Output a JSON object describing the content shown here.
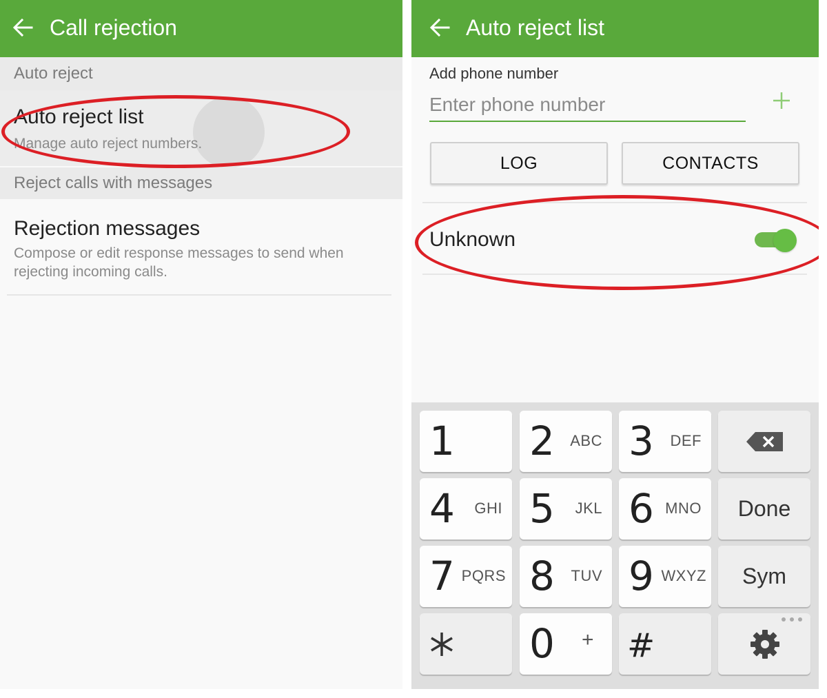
{
  "left_screen": {
    "title": "Call rejection",
    "section_auto_reject": "Auto reject",
    "auto_reject_list": {
      "title": "Auto reject list",
      "subtitle": "Manage auto reject numbers."
    },
    "section_messages": "Reject calls with messages",
    "rejection_messages": {
      "title": "Rejection messages",
      "subtitle": "Compose or edit response messages to send when rejecting incoming calls."
    }
  },
  "right_screen": {
    "title": "Auto reject list",
    "add_label": "Add phone number",
    "input_value": "",
    "input_placeholder": "Enter phone number",
    "log_button": "LOG",
    "contacts_button": "CONTACTS",
    "unknown_label": "Unknown",
    "unknown_enabled": true
  },
  "keypad": {
    "keys": [
      {
        "digit": "1",
        "letters": ""
      },
      {
        "digit": "2",
        "letters": "ABC"
      },
      {
        "digit": "3",
        "letters": "DEF"
      },
      {
        "digit": "4",
        "letters": "GHI"
      },
      {
        "digit": "5",
        "letters": "JKL"
      },
      {
        "digit": "6",
        "letters": "MNO"
      },
      {
        "digit": "7",
        "letters": "PQRS"
      },
      {
        "digit": "8",
        "letters": "TUV"
      },
      {
        "digit": "9",
        "letters": "WXYZ"
      },
      {
        "digit": "0",
        "letters": "+"
      }
    ],
    "done_label": "Done",
    "sym_label": "Sym",
    "hash_label": "#"
  },
  "icons": {
    "back": "back-arrow-icon",
    "add": "plus-icon",
    "backspace": "backspace-icon",
    "settings": "gear-icon",
    "star": "asterisk-icon"
  },
  "colors": {
    "app_bar": "#59a93b",
    "accent": "#66bd45",
    "annotation": "#dc1f25"
  }
}
